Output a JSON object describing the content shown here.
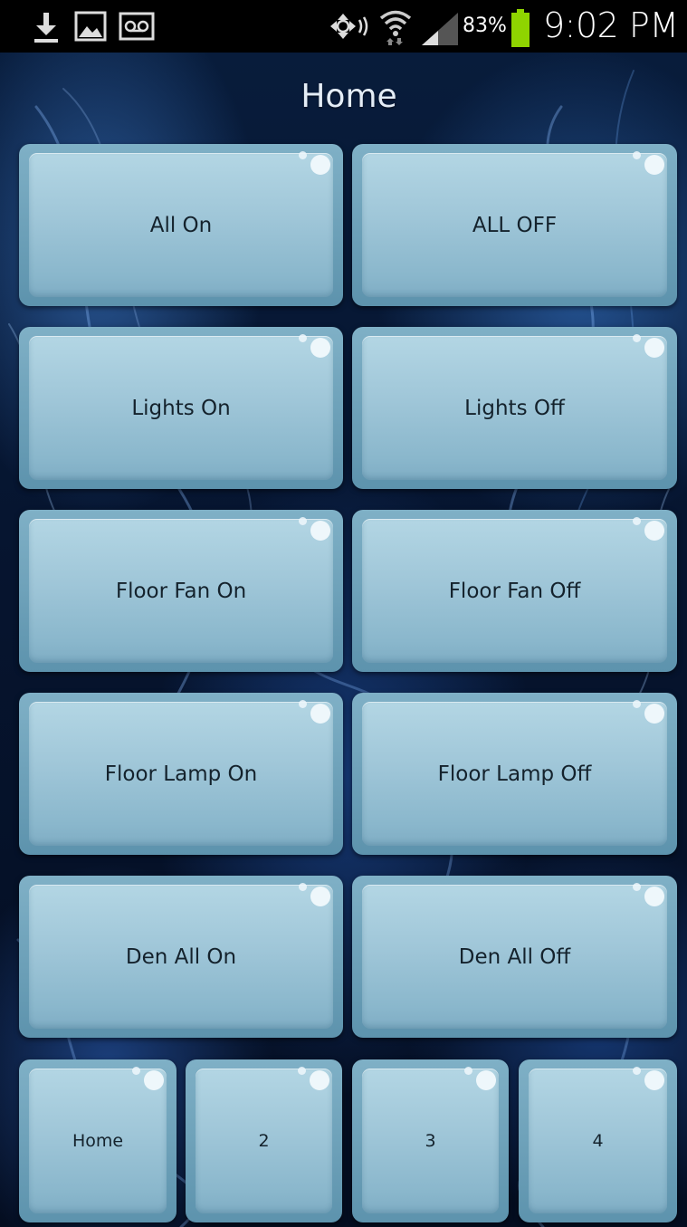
{
  "status_bar": {
    "icons": [
      "download-icon",
      "image-icon",
      "voicemail-icon",
      "nfc-icon",
      "wifi-icon",
      "signal-icon",
      "battery-icon"
    ],
    "battery_percent": "83%",
    "time": "9:02 PM",
    "battery_color": "#8fd400"
  },
  "page": {
    "title": "Home"
  },
  "buttons": [
    {
      "label": "All On"
    },
    {
      "label": "ALL OFF"
    },
    {
      "label": "Lights On"
    },
    {
      "label": "Lights Off"
    },
    {
      "label": "Floor Fan On"
    },
    {
      "label": "Floor Fan Off"
    },
    {
      "label": "Floor Lamp On"
    },
    {
      "label": "Floor Lamp Off"
    },
    {
      "label": "Den All On"
    },
    {
      "label": "Den All Off"
    }
  ],
  "page_tabs": [
    {
      "label": "Home"
    },
    {
      "label": "2"
    },
    {
      "label": "3"
    },
    {
      "label": "4"
    }
  ],
  "colors": {
    "button_face": "#a9d0e0",
    "button_rim": "#6fa3bb",
    "background": "#061530"
  }
}
